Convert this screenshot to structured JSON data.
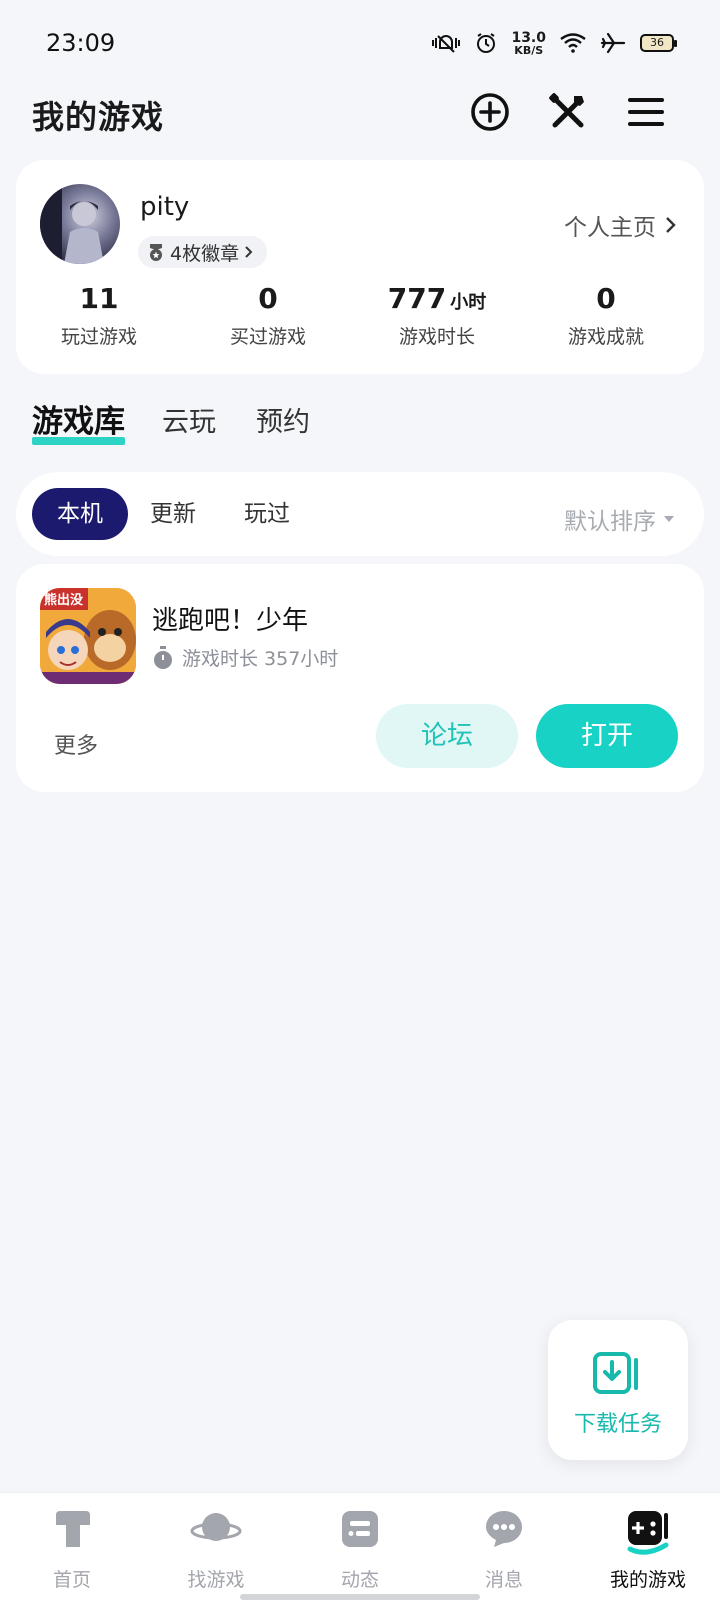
{
  "status_bar": {
    "time": "23:09",
    "net_speed_value": "13.0",
    "net_speed_unit": "KB/S",
    "battery_level": "36",
    "icons": [
      "mute-vibrate-icon",
      "alarm-icon",
      "wifi-icon",
      "airplane-icon",
      "battery-icon"
    ]
  },
  "header": {
    "title": "我的游戏",
    "icons": [
      "add-circle-icon",
      "tools-icon",
      "menu-icon"
    ]
  },
  "profile": {
    "username": "pity",
    "badge_label": "4枚徽章",
    "homepage_label": "个人主页",
    "stats": [
      {
        "value": "11",
        "unit": "",
        "label": "玩过游戏"
      },
      {
        "value": "0",
        "unit": "",
        "label": "买过游戏"
      },
      {
        "value": "777",
        "unit": "小时",
        "label": "游戏时长"
      },
      {
        "value": "0",
        "unit": "",
        "label": "游戏成就"
      }
    ]
  },
  "main_tabs": [
    {
      "label": "游戏库",
      "active": true
    },
    {
      "label": "云玩",
      "active": false
    },
    {
      "label": "预约",
      "active": false
    }
  ],
  "filter": {
    "chips": [
      {
        "label": "本机",
        "active": true
      },
      {
        "label": "更新",
        "active": false
      },
      {
        "label": "玩过",
        "active": false
      }
    ],
    "sort_label": "默认排序"
  },
  "game": {
    "title": "逃跑吧！少年",
    "playtime": "游戏时长 357小时",
    "icon_text": "熊出没",
    "more_label": "更多",
    "forum_label": "论坛",
    "open_label": "打开"
  },
  "download_fab": {
    "label": "下载任务"
  },
  "bottom_nav": [
    {
      "label": "首页",
      "icon": "home-icon",
      "active": false
    },
    {
      "label": "找游戏",
      "icon": "planet-icon",
      "active": false
    },
    {
      "label": "动态",
      "icon": "feed-icon",
      "active": false
    },
    {
      "label": "消息",
      "icon": "message-icon",
      "active": false
    },
    {
      "label": "我的游戏",
      "icon": "gamepad-icon",
      "active": true
    }
  ],
  "colors": {
    "accent": "#18d3c5",
    "active_chip": "#1c1a6e",
    "background": "#f4f6f9"
  }
}
